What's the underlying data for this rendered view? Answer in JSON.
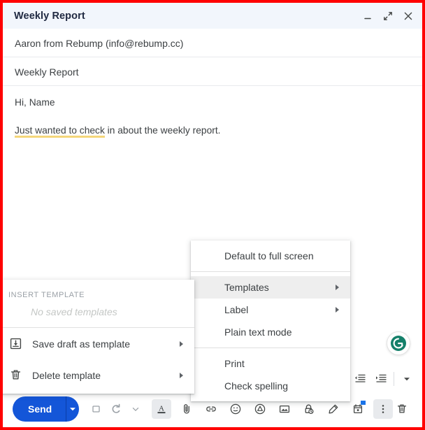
{
  "window": {
    "title": "Weekly Report",
    "minimize_label": "—",
    "expand_label": "expand",
    "close_label": "×"
  },
  "compose": {
    "recipient": "Aaron from Rebump (info@rebump.cc)",
    "subject": "Weekly Report",
    "body_greeting": "Hi, Name",
    "body_highlight": "Just wanted to check",
    "body_rest": " in about the weekly report."
  },
  "grammarly": {
    "letter": "G",
    "color": "#15806a"
  },
  "context_menu": {
    "items": [
      {
        "label": "Default to full screen",
        "submenu": false,
        "highlight": false
      },
      {
        "label": "Templates",
        "submenu": true,
        "highlight": true
      },
      {
        "label": "Label",
        "submenu": true,
        "highlight": false
      },
      {
        "label": "Plain text mode",
        "submenu": false,
        "highlight": false
      },
      {
        "label": "Print",
        "submenu": false,
        "highlight": false
      },
      {
        "label": "Check spelling",
        "submenu": false,
        "highlight": false
      }
    ]
  },
  "templates_submenu": {
    "header": "INSERT TEMPLATE",
    "empty_text": "No saved templates",
    "items": [
      {
        "label": "Save draft as template",
        "icon": "save-download-icon"
      },
      {
        "label": "Delete template",
        "icon": "trash-icon"
      }
    ]
  },
  "toolbar": {
    "send_label": "Send",
    "send_color": "#1456d8",
    "send_caret": "▾",
    "icons": [
      "format-options-icon",
      "attach-file-icon",
      "insert-link-icon",
      "insert-emoji-icon",
      "insert-drive-icon",
      "insert-photo-icon",
      "confidential-mode-icon",
      "insert-signature-icon",
      "schedule-send-icon",
      "more-options-icon",
      "discard-draft-icon"
    ]
  },
  "format_strip": {
    "icons": [
      "indent-less-icon",
      "indent-more-icon",
      "more-format-icon"
    ]
  },
  "annotation": {
    "border_color": "#ff0000"
  }
}
